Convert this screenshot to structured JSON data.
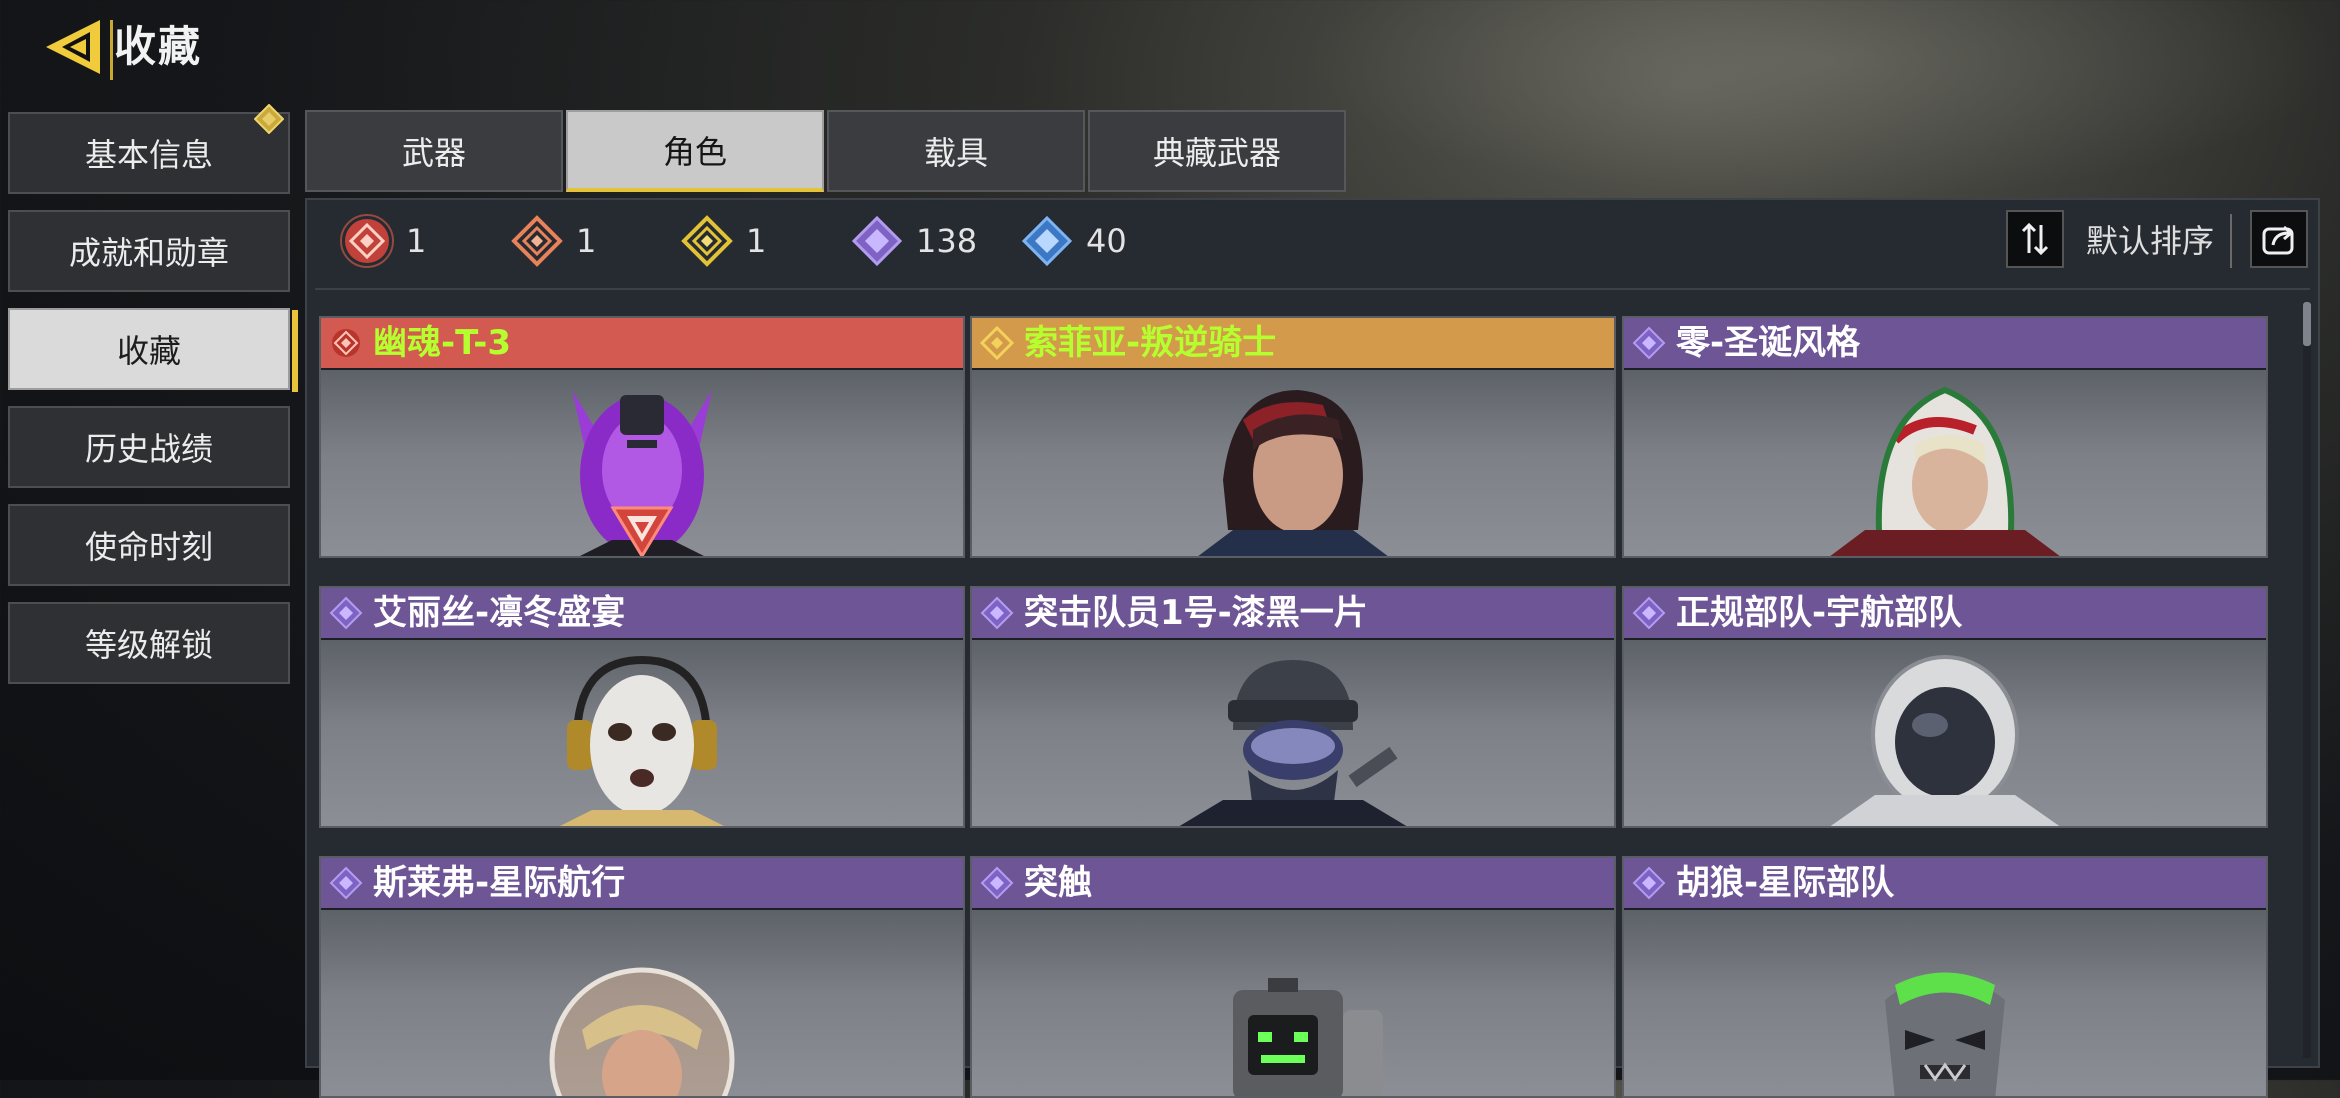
{
  "header": {
    "title": "收藏",
    "accent": "#e9c33a"
  },
  "sidebar": {
    "items": [
      {
        "label": "基本信息",
        "active": false,
        "notice": true
      },
      {
        "label": "成就和勋章",
        "active": false
      },
      {
        "label": "收藏",
        "active": true
      },
      {
        "label": "历史战绩",
        "active": false
      },
      {
        "label": "使命时刻",
        "active": false
      },
      {
        "label": "等级解锁",
        "active": false
      }
    ]
  },
  "tabs": [
    {
      "label": "武器",
      "active": false
    },
    {
      "label": "角色",
      "active": true
    },
    {
      "label": "载具",
      "active": false
    },
    {
      "label": "典藏武器",
      "active": false
    }
  ],
  "rarity_counts": [
    {
      "tier": "mythic",
      "icon": "red-rarity-icon",
      "color": "#d2453c",
      "count": "1"
    },
    {
      "tier": "legendary",
      "icon": "orange-rarity-icon",
      "color": "#e8825a",
      "count": "1"
    },
    {
      "tier": "epic",
      "icon": "gold-rarity-icon",
      "color": "#e2c236",
      "count": "1"
    },
    {
      "tier": "rare",
      "icon": "purple-rarity-icon",
      "color": "#a98be6",
      "count": "138"
    },
    {
      "tier": "uncommon",
      "icon": "blue-rarity-icon",
      "color": "#5aa0e8",
      "count": "40"
    }
  ],
  "sort": {
    "label": "默认排序",
    "icon": "sort-icon",
    "share_icon": "share-icon"
  },
  "cards": [
    {
      "name": "幽魂-T-3",
      "rarity": "red",
      "badge": true
    },
    {
      "name": "索菲亚-叛逆骑士",
      "rarity": "orange"
    },
    {
      "name": "零-圣诞风格",
      "rarity": "purple"
    },
    {
      "name": "艾丽丝-凛冬盛宴",
      "rarity": "purple"
    },
    {
      "name": "突击队员1号-漆黑一片",
      "rarity": "purple"
    },
    {
      "name": "正规部队-宇航部队",
      "rarity": "purple"
    },
    {
      "name": "斯莱弗-星际航行",
      "rarity": "purple"
    },
    {
      "name": "突触",
      "rarity": "purple"
    },
    {
      "name": "胡狼-星际部队",
      "rarity": "purple"
    }
  ]
}
